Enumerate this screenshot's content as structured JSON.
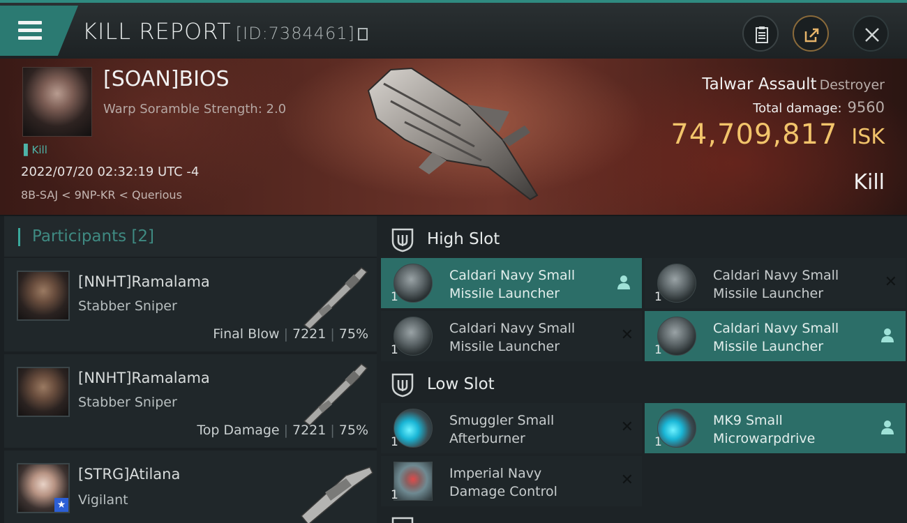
{
  "header": {
    "title": "KILL REPORT",
    "report_id": "[ID:7384461]"
  },
  "victim": {
    "name": "[SOAN]BIOS",
    "subtitle": "Warp Soramble Strength: 2.0",
    "tag": "Kill",
    "datetime": "2022/07/20 02:32:19 UTC -4",
    "route": "8B-SAJ < 9NP-KR < Querious",
    "ship": "Talwar Assault",
    "ship_class": "Destroyer",
    "total_damage_label": "Total damage:",
    "total_damage": "9560",
    "isk_value": "74,709,817",
    "isk_unit": "ISK",
    "result": "Kill"
  },
  "participants": {
    "title": "Participants",
    "count": "[2]",
    "items": [
      {
        "name": "[NNHT]Ramalama",
        "ship": "Stabber Sniper",
        "role": "Final Blow",
        "damage": "7221",
        "percent": "75%"
      },
      {
        "name": "[NNHT]Ramalama",
        "ship": "Stabber Sniper",
        "role": "Top Damage",
        "damage": "7221",
        "percent": "75%"
      },
      {
        "name": "[STRG]Atilana",
        "ship": "Vigilant"
      }
    ]
  },
  "fittings": {
    "high_slot_label": "High Slot",
    "low_slot_label": "Low Slot",
    "high": [
      {
        "line1": "Caldari Navy Small",
        "line2": "Missile Launcher",
        "qty": "1",
        "status": "dropped"
      },
      {
        "line1": "Caldari Navy Small",
        "line2": "Missile Launcher",
        "qty": "1",
        "status": "destroyed"
      },
      {
        "line1": "Caldari Navy Small",
        "line2": "Missile Launcher",
        "qty": "1",
        "status": "destroyed"
      },
      {
        "line1": "Caldari Navy Small",
        "line2": "Missile Launcher",
        "qty": "1",
        "status": "dropped"
      }
    ],
    "low": [
      {
        "line1": "Smuggler Small",
        "line2": "Afterburner",
        "qty": "1",
        "status": "destroyed"
      },
      {
        "line1": "MK9 Small",
        "line2": "Microwarpdrive",
        "qty": "1",
        "status": "dropped"
      },
      {
        "line1": "Imperial Navy",
        "line2": "Damage Control",
        "qty": "1",
        "status": "destroyed"
      }
    ]
  },
  "colors": {
    "accent": "#2f8a80",
    "isk": "#f2c46b",
    "active_module": "#2c6e68"
  }
}
